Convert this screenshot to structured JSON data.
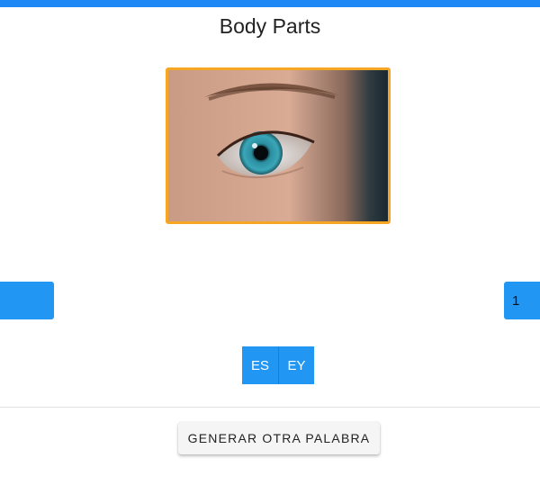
{
  "header": {
    "title": "Body Parts",
    "accent_color": "#1e88f5"
  },
  "image": {
    "subject": "eye",
    "frame_color": "#f5a623"
  },
  "navigation": {
    "left_label": "",
    "right_label": "1",
    "button_color": "#2196f3"
  },
  "syllables": [
    "ES",
    "EY"
  ],
  "actions": {
    "generate_label": "GENERAR OTRA PALABRA"
  }
}
